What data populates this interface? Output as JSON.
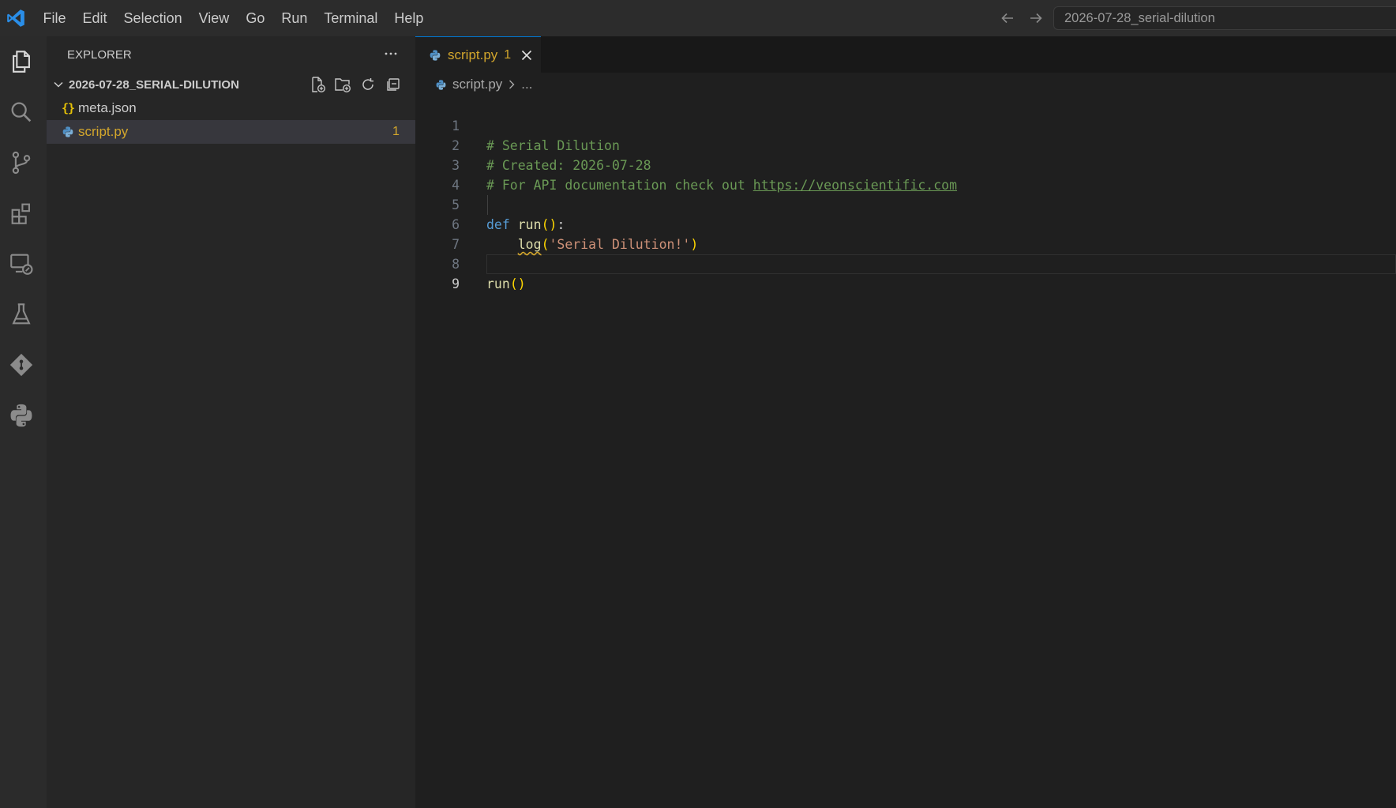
{
  "menu": [
    "File",
    "Edit",
    "Selection",
    "View",
    "Go",
    "Run",
    "Terminal",
    "Help"
  ],
  "command_center": {
    "text": "2026-07-28_serial-dilution"
  },
  "activity_bar": [
    "files-icon",
    "search-icon",
    "source-control-icon",
    "extensions-icon",
    "remote-explorer-icon",
    "testing-flask-icon",
    "git-diamond-icon",
    "python-icon"
  ],
  "sidebar": {
    "title": "EXPLORER",
    "more": "···",
    "folder": "2026-07-28_SERIAL-DILUTION",
    "files": [
      {
        "icon": "{}",
        "name": "meta.json",
        "badge": ""
      },
      {
        "icon": "python-file-icon",
        "name": "script.py",
        "badge": "1"
      }
    ]
  },
  "editor": {
    "tab": {
      "label": "script.py",
      "badge": "1"
    },
    "breadcrumb": {
      "file": "script.py",
      "ellipsis": "..."
    },
    "line_numbers": [
      "1",
      "2",
      "3",
      "4",
      "5",
      "6",
      "7",
      "8",
      "9"
    ],
    "code": {
      "l1": "# Serial Dilution",
      "l2": "# Created: 2026-07-28",
      "l3_prefix": "# For API documentation check out ",
      "l3_link": "https://veonscientific.com",
      "l5_kw": "def",
      "l5_fn": "run",
      "l5_paren": "()",
      "l5_colon": ":",
      "l6_fn": "log",
      "l6_open": "(",
      "l6_str": "'Serial Dilution!'",
      "l6_close": ")",
      "l8_fn": "run",
      "l8_paren": "()"
    }
  },
  "colors": {
    "accent": "#0078d4",
    "warning": "#d4a72c",
    "comment": "#6a9955",
    "keyword": "#569cd6",
    "function": "#dcdcaa",
    "string": "#ce9178"
  }
}
